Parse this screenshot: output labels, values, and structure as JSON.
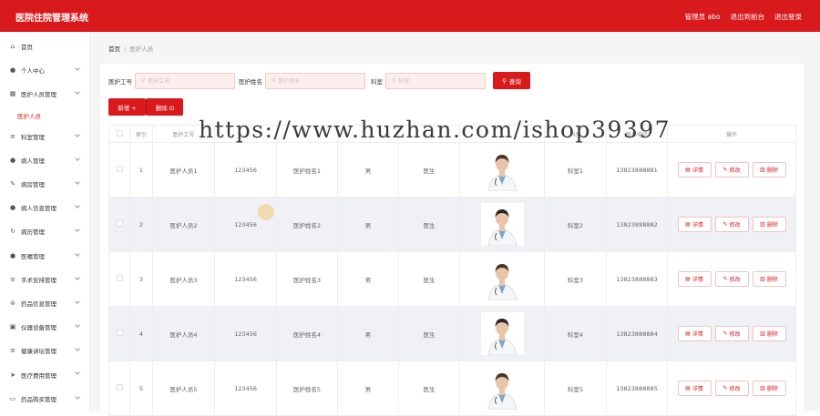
{
  "header": {
    "title": "医院住院管理系统",
    "user": "管理员 abo",
    "backend_link": "退出到前台",
    "logout": "退出登录"
  },
  "sidebar": {
    "items": [
      {
        "label": "首页",
        "icon": "home-icon",
        "glyph": "⌂",
        "chevron": false
      },
      {
        "label": "个人中心",
        "icon": "user-icon",
        "glyph": "●",
        "chevron": true
      },
      {
        "label": "医护人员管理",
        "icon": "grid-icon",
        "glyph": "▦",
        "chevron": true
      },
      {
        "label": "科室管理",
        "icon": "list-icon",
        "glyph": "≡",
        "chevron": true
      },
      {
        "label": "病人管理",
        "icon": "user-icon",
        "glyph": "●",
        "chevron": true
      },
      {
        "label": "病房管理",
        "icon": "tool-icon",
        "glyph": "✎",
        "chevron": true
      },
      {
        "label": "病人信息管理",
        "icon": "user-icon",
        "glyph": "●",
        "chevron": true
      },
      {
        "label": "病历管理",
        "icon": "refresh-icon",
        "glyph": "↻",
        "chevron": true
      },
      {
        "label": "医嘱管理",
        "icon": "user-icon",
        "glyph": "●",
        "chevron": true
      },
      {
        "label": "手术安排管理",
        "icon": "list-icon",
        "glyph": "≡",
        "chevron": true
      },
      {
        "label": "药品信息管理",
        "icon": "coin-icon",
        "glyph": "⊜",
        "chevron": true
      },
      {
        "label": "仪器设备管理",
        "icon": "box-icon",
        "glyph": "▣",
        "chevron": true
      },
      {
        "label": "健康讲坛管理",
        "icon": "list-icon",
        "glyph": "≡",
        "chevron": true
      },
      {
        "label": "医疗费用管理",
        "icon": "send-icon",
        "glyph": "➤",
        "chevron": true
      },
      {
        "label": "药品购买管理",
        "icon": "chat-icon",
        "glyph": "▭",
        "chevron": true
      }
    ],
    "subitem": "医护人员"
  },
  "breadcrumb": {
    "home": "首页",
    "separator": "/",
    "current": "医护人员"
  },
  "search": {
    "f1_label": "医护工号",
    "f1_placeholder": "医护工号",
    "f2_label": "医护姓名",
    "f2_placeholder": "医护姓名",
    "f3_label": "科室",
    "f3_placeholder": "科室",
    "query": "查询"
  },
  "actions": {
    "add": "新增 +",
    "delete": "删除 ⊡"
  },
  "table": {
    "headers": [
      "",
      "索引",
      "医护工号",
      "",
      "",
      "",
      "",
      "",
      "科室",
      "联系电话",
      "操作"
    ],
    "rows": [
      {
        "idx": "1",
        "no": "医护人员1",
        "pwd": "123456",
        "name": "医护姓名1",
        "sex": "男",
        "title": "医生",
        "dept": "科室1",
        "phone": "13823888881"
      },
      {
        "idx": "2",
        "no": "医护人员2",
        "pwd": "123456",
        "name": "医护姓名2",
        "sex": "男",
        "title": "医生",
        "dept": "科室2",
        "phone": "13823888882"
      },
      {
        "idx": "3",
        "no": "医护人员3",
        "pwd": "123456",
        "name": "医护姓名3",
        "sex": "男",
        "title": "医生",
        "dept": "科室3",
        "phone": "13823888883"
      },
      {
        "idx": "4",
        "no": "医护人员4",
        "pwd": "123456",
        "name": "医护姓名4",
        "sex": "男",
        "title": "医生",
        "dept": "科室4",
        "phone": "13823888884"
      },
      {
        "idx": "5",
        "no": "医护人员5",
        "pwd": "123456",
        "name": "医护姓名5",
        "sex": "男",
        "title": "医生",
        "dept": "科室5",
        "phone": "13823888885"
      }
    ],
    "detail": "详情",
    "edit": "修改",
    "remove": "删除"
  },
  "watermark": "https://www.huzhan.com/ishop39397",
  "colors": {
    "primary": "#d91a1c",
    "alt_row": "#f0f1f5",
    "sidebar_active": "#d91a1c"
  }
}
